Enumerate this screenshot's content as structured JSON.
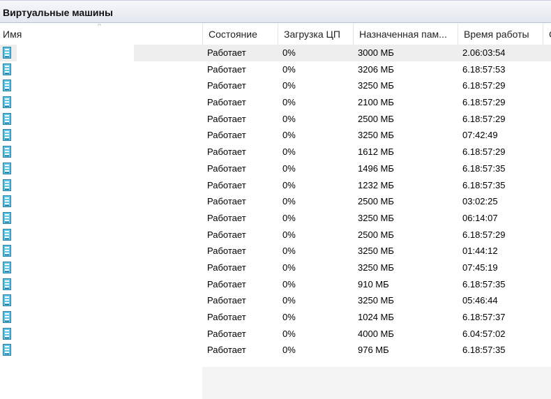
{
  "panel": {
    "title": "Виртуальные машины"
  },
  "columns": {
    "name": "Имя",
    "state": "Состояние",
    "cpu": "Загрузка ЦП",
    "memory": "Назначенная пам...",
    "uptime": "Время работы",
    "extra": "С"
  },
  "vms": [
    {
      "state": "Работает",
      "cpu": "0%",
      "memory": "3000 МБ",
      "uptime": "2.06:03:54"
    },
    {
      "state": "Работает",
      "cpu": "0%",
      "memory": "3206 МБ",
      "uptime": "6.18:57:53"
    },
    {
      "state": "Работает",
      "cpu": "0%",
      "memory": "3250 МБ",
      "uptime": "6.18:57:29"
    },
    {
      "state": "Работает",
      "cpu": "0%",
      "memory": "2100 МБ",
      "uptime": "6.18:57:29"
    },
    {
      "state": "Работает",
      "cpu": "0%",
      "memory": "2500 МБ",
      "uptime": "6.18:57:29"
    },
    {
      "state": "Работает",
      "cpu": "0%",
      "memory": "3250 МБ",
      "uptime": "07:42:49"
    },
    {
      "state": "Работает",
      "cpu": "0%",
      "memory": "1612 МБ",
      "uptime": "6.18:57:29"
    },
    {
      "state": "Работает",
      "cpu": "0%",
      "memory": "1496 МБ",
      "uptime": "6.18:57:35"
    },
    {
      "state": "Работает",
      "cpu": "0%",
      "memory": "1232 МБ",
      "uptime": "6.18:57:35"
    },
    {
      "state": "Работает",
      "cpu": "0%",
      "memory": "2500 МБ",
      "uptime": "03:02:25"
    },
    {
      "state": "Работает",
      "cpu": "0%",
      "memory": "3250 МБ",
      "uptime": "06:14:07"
    },
    {
      "state": "Работает",
      "cpu": "0%",
      "memory": "2500 МБ",
      "uptime": "6.18:57:29"
    },
    {
      "state": "Работает",
      "cpu": "0%",
      "memory": "3250 МБ",
      "uptime": "01:44:12"
    },
    {
      "state": "Работает",
      "cpu": "0%",
      "memory": "3250 МБ",
      "uptime": "07:45:19"
    },
    {
      "state": "Работает",
      "cpu": "0%",
      "memory": "910 МБ",
      "uptime": "6.18:57:35"
    },
    {
      "state": "Работает",
      "cpu": "0%",
      "memory": "3250 МБ",
      "uptime": "05:46:44"
    },
    {
      "state": "Работает",
      "cpu": "0%",
      "memory": "1024 МБ",
      "uptime": "6.18:57:37"
    },
    {
      "state": "Работает",
      "cpu": "0%",
      "memory": "4000 МБ",
      "uptime": "6.04:57:02"
    },
    {
      "state": "Работает",
      "cpu": "0%",
      "memory": "976 МБ",
      "uptime": "6.18:57:35"
    }
  ],
  "icons": {
    "vm": "virtual-machine-icon",
    "sort": "sort-ascending-icon"
  },
  "colors": {
    "vm_icon": "#5fc3e4",
    "selected_row": "#eeeeee"
  }
}
